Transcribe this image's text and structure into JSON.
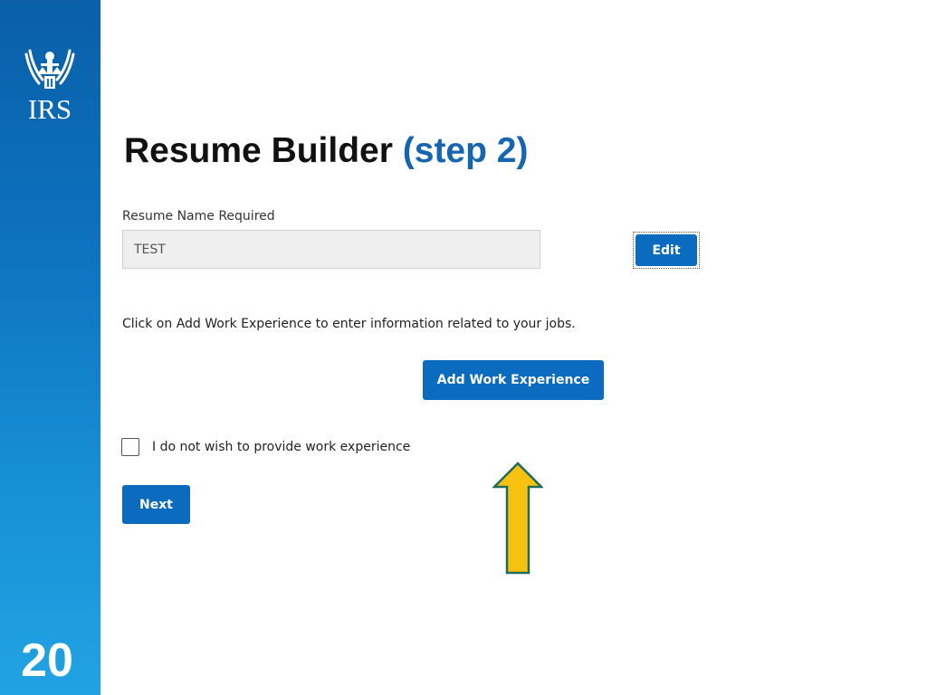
{
  "sidebar": {
    "logo_text": "IRS",
    "slide_number": "20",
    "color_top": "#0a5fa8",
    "color_bottom": "#21a3e3"
  },
  "page": {
    "title": "Resume Builder",
    "title_step": "(step 2)",
    "title_step_color": "#1565b0"
  },
  "form": {
    "resume_name_label": "Resume Name Required",
    "resume_name_value": "TEST",
    "edit_label": "Edit",
    "instruction": "Click on Add Work Experience to enter information related to your jobs.",
    "add_work_label": "Add Work Experience",
    "no_work_checkbox_label": "I do not wish to provide work experience",
    "no_work_checked": false,
    "next_label": "Next",
    "button_color": "#0b6bbf"
  },
  "annotation": {
    "arrow_icon": "up-arrow-icon",
    "arrow_color": "#f7c10f",
    "arrow_outline": "#1f6b5c"
  }
}
